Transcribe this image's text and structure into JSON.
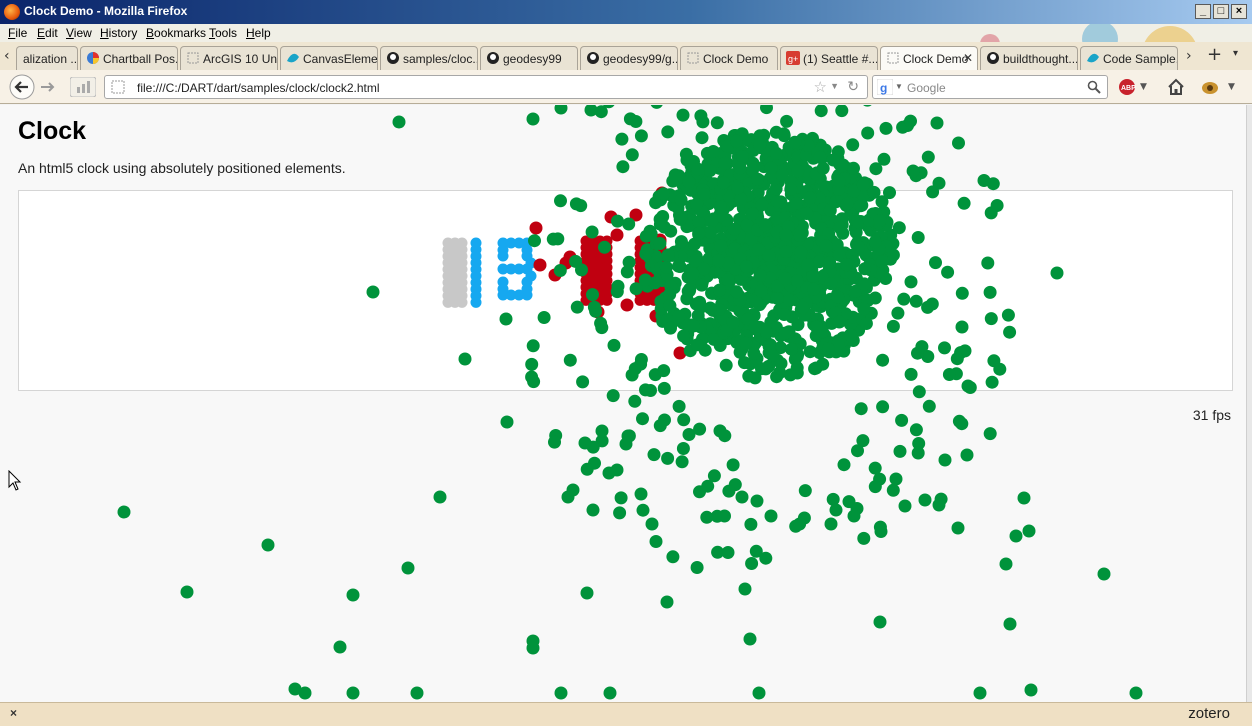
{
  "window": {
    "title": "Clock Demo - Mozilla Firefox"
  },
  "menu": [
    "File",
    "Edit",
    "View",
    "History",
    "Bookmarks",
    "Tools",
    "Help"
  ],
  "tabs": [
    {
      "label": "alization ...",
      "icon": "page-icon"
    },
    {
      "label": "Chartball Pos...",
      "icon": "chartball-icon"
    },
    {
      "label": "ArcGIS 10 Un...",
      "icon": "page-icon"
    },
    {
      "label": "CanvasEleme...",
      "icon": "canvas-icon"
    },
    {
      "label": "samples/cloc...",
      "icon": "github-icon"
    },
    {
      "label": "geodesy99",
      "icon": "github-icon"
    },
    {
      "label": "geodesy99/g...",
      "icon": "github-icon"
    },
    {
      "label": "Clock Demo",
      "icon": "page-icon"
    },
    {
      "label": "(1) Seattle #...",
      "icon": "gplus-icon"
    },
    {
      "label": "Clock Demo",
      "icon": "page-icon",
      "active": true
    },
    {
      "label": "buildthought...",
      "icon": "github-icon"
    },
    {
      "label": "Code Sample...",
      "icon": "canvas-icon"
    }
  ],
  "nav": {
    "url": "file:///C:/DART/dart/samples/clock/clock2.html",
    "search_placeholder": "Google"
  },
  "page": {
    "title": "Clock",
    "description": "An html5 clock using absolutely positioned elements.",
    "fps": "31 fps"
  },
  "status": {
    "close": "×",
    "zotero": "zotero"
  },
  "colors": {
    "green": "#00933b",
    "red": "#c00010",
    "blue": "#16a8f0",
    "gray": "#c8c8c8"
  }
}
